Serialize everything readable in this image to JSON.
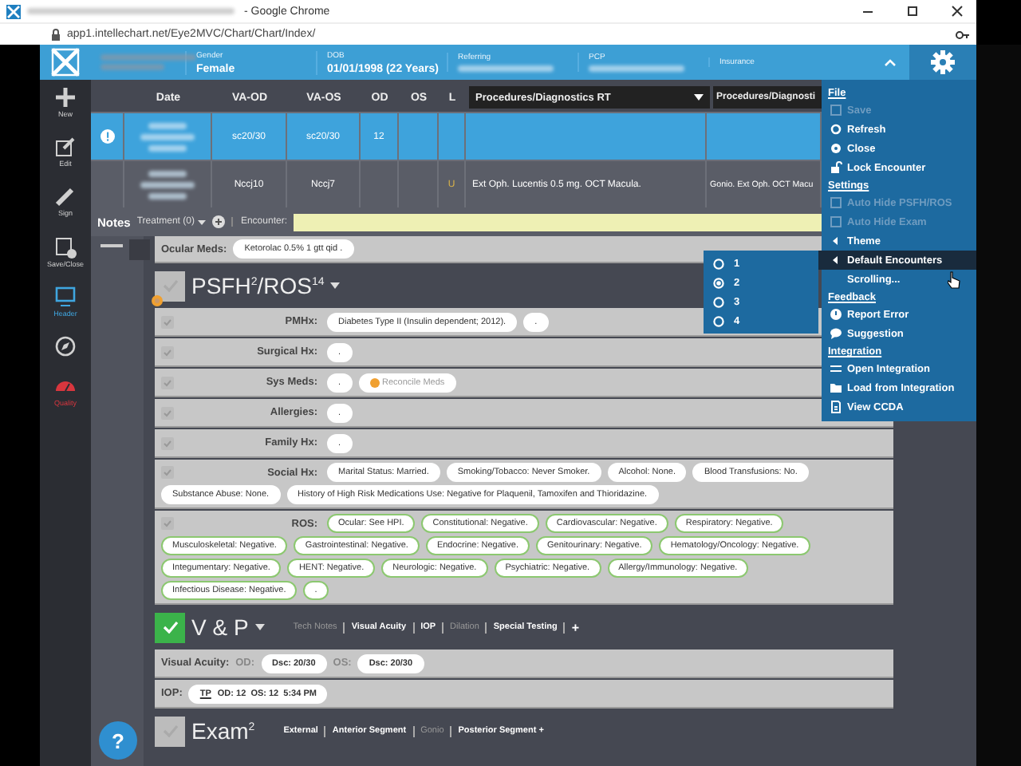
{
  "browser": {
    "title": "- Google Chrome",
    "url": "app1.intellechart.net/Eye2MVC/Chart/Chart/Index/"
  },
  "header": {
    "fields": [
      {
        "label": "Gender",
        "value": "Female"
      },
      {
        "label": "DOB",
        "value": "01/01/1998 (22 Years)"
      },
      {
        "label": "Referring",
        "redacted": true
      },
      {
        "label": "PCP",
        "redacted": true
      },
      {
        "label": "Insurance"
      }
    ]
  },
  "sidebar": {
    "items": [
      {
        "label": "New",
        "color": "#d0d0d0"
      },
      {
        "label": "Edit",
        "color": "#d0d0d0"
      },
      {
        "label": "Sign",
        "color": "#d0d0d0"
      },
      {
        "label": "Save/Close",
        "color": "#d0d0d0"
      },
      {
        "label": "Header",
        "color": "#3fa6e0"
      },
      {
        "color": "#d0d0d0"
      },
      {
        "label": "Quality",
        "color": "#d8363e"
      }
    ]
  },
  "table": {
    "columns": [
      "Date",
      "VA-OD",
      "VA-OS",
      "OD",
      "OS",
      "L",
      "Procedures/Diagnostics RT",
      "Procedures/Diagnosti"
    ],
    "rows": [
      {
        "selected": true,
        "alert": true,
        "va_od": "sc20/30",
        "va_os": "sc20/30",
        "od": "12"
      },
      {
        "selected": false,
        "alert": false,
        "va_od": "Nccj10",
        "va_os": "Nccj7",
        "l": "U",
        "procedures_rt": "Ext Oph. Lucentis 0.5 mg. OCT Macula.",
        "procedures_2": "Gonio. Ext Oph. OCT Macu"
      }
    ]
  },
  "notes_bar": {
    "title": "Notes",
    "treatment": "Treatment (0)",
    "encounter_label": "Encounter:"
  },
  "ocular_meds": {
    "label": "Ocular Meds:",
    "values": [
      "Ketorolac 0.5% 1 gtt qid ."
    ]
  },
  "psfh": {
    "title": "PSFH$^{2}$/ROS$^{14}$",
    "checked": false,
    "rows": [
      {
        "label": "PMHx:",
        "checked": false,
        "values": [
          "Diabetes Type II (Insulin dependent; 2012).",
          "."
        ]
      },
      {
        "label": "Surgical Hx:",
        "checked": false,
        "values": [
          "."
        ]
      },
      {
        "label": "Sys Meds:",
        "checked": false,
        "values": [
          "."
        ],
        "action": "Reconcile Meds"
      },
      {
        "label": "Allergies:",
        "checked": false,
        "values": [
          "."
        ]
      },
      {
        "label": "Family Hx:",
        "checked": false,
        "values": [
          "."
        ]
      },
      {
        "label": "Social Hx:",
        "checked": false,
        "values": [
          "Marital Status: Married.",
          "Smoking/Tobacco: Never Smoker.",
          "Alcohol: None.",
          "Blood Transfusions: No.",
          "Substance Abuse: None.",
          "History of High Risk Medications Use: Negative for Plaquenil, Tamoxifen and Thioridazine."
        ]
      },
      {
        "label": "ROS:",
        "checked": false,
        "reviewed": true,
        "values": [
          "Ocular: See HPI.",
          "Constitutional: Negative.",
          "Cardiovascular: Negative.",
          "Respiratory: Negative.",
          "Musculoskeletal: Negative.",
          "Gastrointestinal: Negative.",
          "Endocrine: Negative.",
          "Genitourinary: Negative.",
          "Hematology/Oncology: Negative.",
          "Integumentary: Negative.",
          "HENT: Negative.",
          "Neurologic: Negative.",
          "Psychiatric: Negative.",
          "Allergy/Immunology: Negative.",
          "Infectious Disease: Negative.",
          "."
        ]
      }
    ]
  },
  "vp": {
    "title": "V & P",
    "checked": true,
    "tabs": [
      {
        "label": "Tech Notes",
        "dim": true
      },
      {
        "label": "Visual Acuity",
        "dim": false
      },
      {
        "label": "IOP",
        "dim": false
      },
      {
        "label": "Dilation",
        "dim": true
      },
      {
        "label": "Special Testing",
        "dim": false
      }
    ],
    "add": "+",
    "visual_acuity": {
      "label": "Visual Acuity:",
      "od_label": "OD:",
      "od": "Dsc: 20/30",
      "os_label": "OS:",
      "os": "Dsc: 20/30"
    },
    "iop": {
      "label": "IOP:",
      "method": "TP",
      "reading": "OD: 12  OS: 12  5:34 PM"
    }
  },
  "exam": {
    "title": "Exam$^{2}$",
    "checked": false,
    "tabs": [
      {
        "label": "External",
        "dim": false
      },
      {
        "label": "Anterior Segment",
        "dim": false
      },
      {
        "label": "Gonio",
        "dim": true
      },
      {
        "label": "Posterior Segment",
        "dim": false
      }
    ],
    "add": "+"
  },
  "help": "?",
  "menu": {
    "sections": [
      {
        "title": "File",
        "items": [
          {
            "label": "Save",
            "kind": "command",
            "disabled": true
          },
          {
            "label": "Refresh",
            "kind": "command",
            "disabled": false
          },
          {
            "label": "Close",
            "kind": "command",
            "disabled": false
          },
          {
            "label": "Lock Encounter",
            "kind": "command",
            "disabled": false
          }
        ]
      },
      {
        "title": "Settings",
        "items": [
          {
            "label": "Auto Hide PSFH/ROS",
            "kind": "checkbox",
            "disabled": true,
            "checked": false
          },
          {
            "label": "Auto Hide Exam",
            "kind": "checkbox",
            "disabled": true,
            "checked": false
          },
          {
            "label": "Theme",
            "kind": "submenu",
            "disabled": false,
            "selected": false
          },
          {
            "label": "Default Encounters",
            "kind": "submenu",
            "disabled": false,
            "selected": true
          },
          {
            "label": "Scrolling...",
            "kind": "plain",
            "disabled": false
          }
        ]
      },
      {
        "title": "Feedback",
        "items": [
          {
            "label": "Report Error",
            "kind": "command",
            "disabled": false
          },
          {
            "label": "Suggestion",
            "kind": "command",
            "disabled": false
          }
        ]
      },
      {
        "title": "Integration",
        "items": [
          {
            "label": "Open Integration",
            "kind": "command",
            "disabled": false
          },
          {
            "label": "Load from Integration",
            "kind": "command",
            "disabled": false
          },
          {
            "label": "View CCDA",
            "kind": "command",
            "disabled": false
          }
        ]
      }
    ]
  },
  "submenu": {
    "options": [
      {
        "label": "1",
        "selected": false
      },
      {
        "label": "2",
        "selected": true
      },
      {
        "label": "3",
        "selected": false
      },
      {
        "label": "4",
        "selected": false
      }
    ]
  }
}
